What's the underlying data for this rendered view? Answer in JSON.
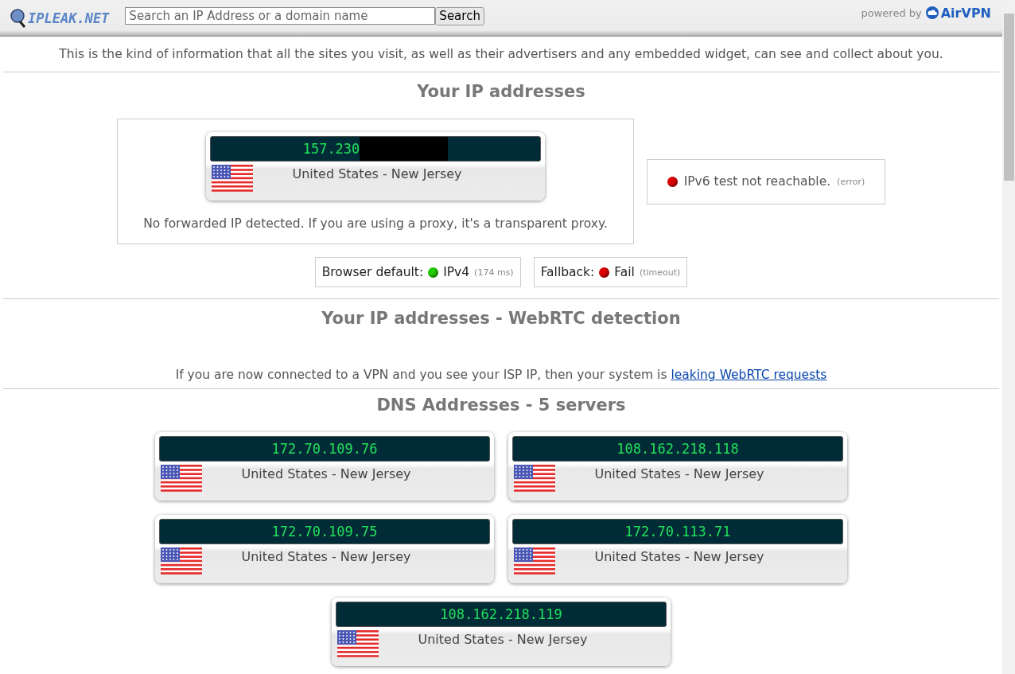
{
  "header": {
    "logo": "IPLEAK.NET",
    "search": {
      "placeholder": "Search an IP Address or a domain name"
    },
    "search_button": "Search",
    "powered_by": "powered by",
    "brand": "AirVPN"
  },
  "intro": "This is the kind of information that all the sites you visit, as well as their advertisers and any embedded widget, can see and collect about you.",
  "ip_section": {
    "title": "Your IP addresses",
    "ip": {
      "address": "157.230",
      "redacted": true,
      "location": "United States - New Jersey"
    },
    "forwarded_note": "No forwarded IP detected. If you are using a proxy, it's a transparent proxy.",
    "ipv6": {
      "text": "IPv6 test not reachable.",
      "detail": "(error)",
      "color": "#dd0000"
    },
    "tests": [
      {
        "label": "Browser default:",
        "result": "IPv4",
        "detail": "(174 ms)",
        "color": "#22cc00"
      },
      {
        "label": "Fallback:",
        "result": "Fail",
        "detail": "(timeout)",
        "color": "#dd0000"
      }
    ]
  },
  "webrtc_section": {
    "title": "Your IP addresses - WebRTC detection",
    "note": "If you are now connected to a VPN and you see your ISP IP, then your system is",
    "link": "leaking WebRTC requests"
  },
  "dns_section": {
    "title": "DNS Addresses - 5 servers",
    "servers": [
      {
        "address": "172.70.109.76",
        "location": "United States - New Jersey"
      },
      {
        "address": "108.162.218.118",
        "location": "United States - New Jersey"
      },
      {
        "address": "172.70.109.75",
        "location": "United States - New Jersey"
      },
      {
        "address": "172.70.113.71",
        "location": "United States - New Jersey"
      },
      {
        "address": "108.162.218.119",
        "location": "United States - New Jersey"
      }
    ]
  }
}
